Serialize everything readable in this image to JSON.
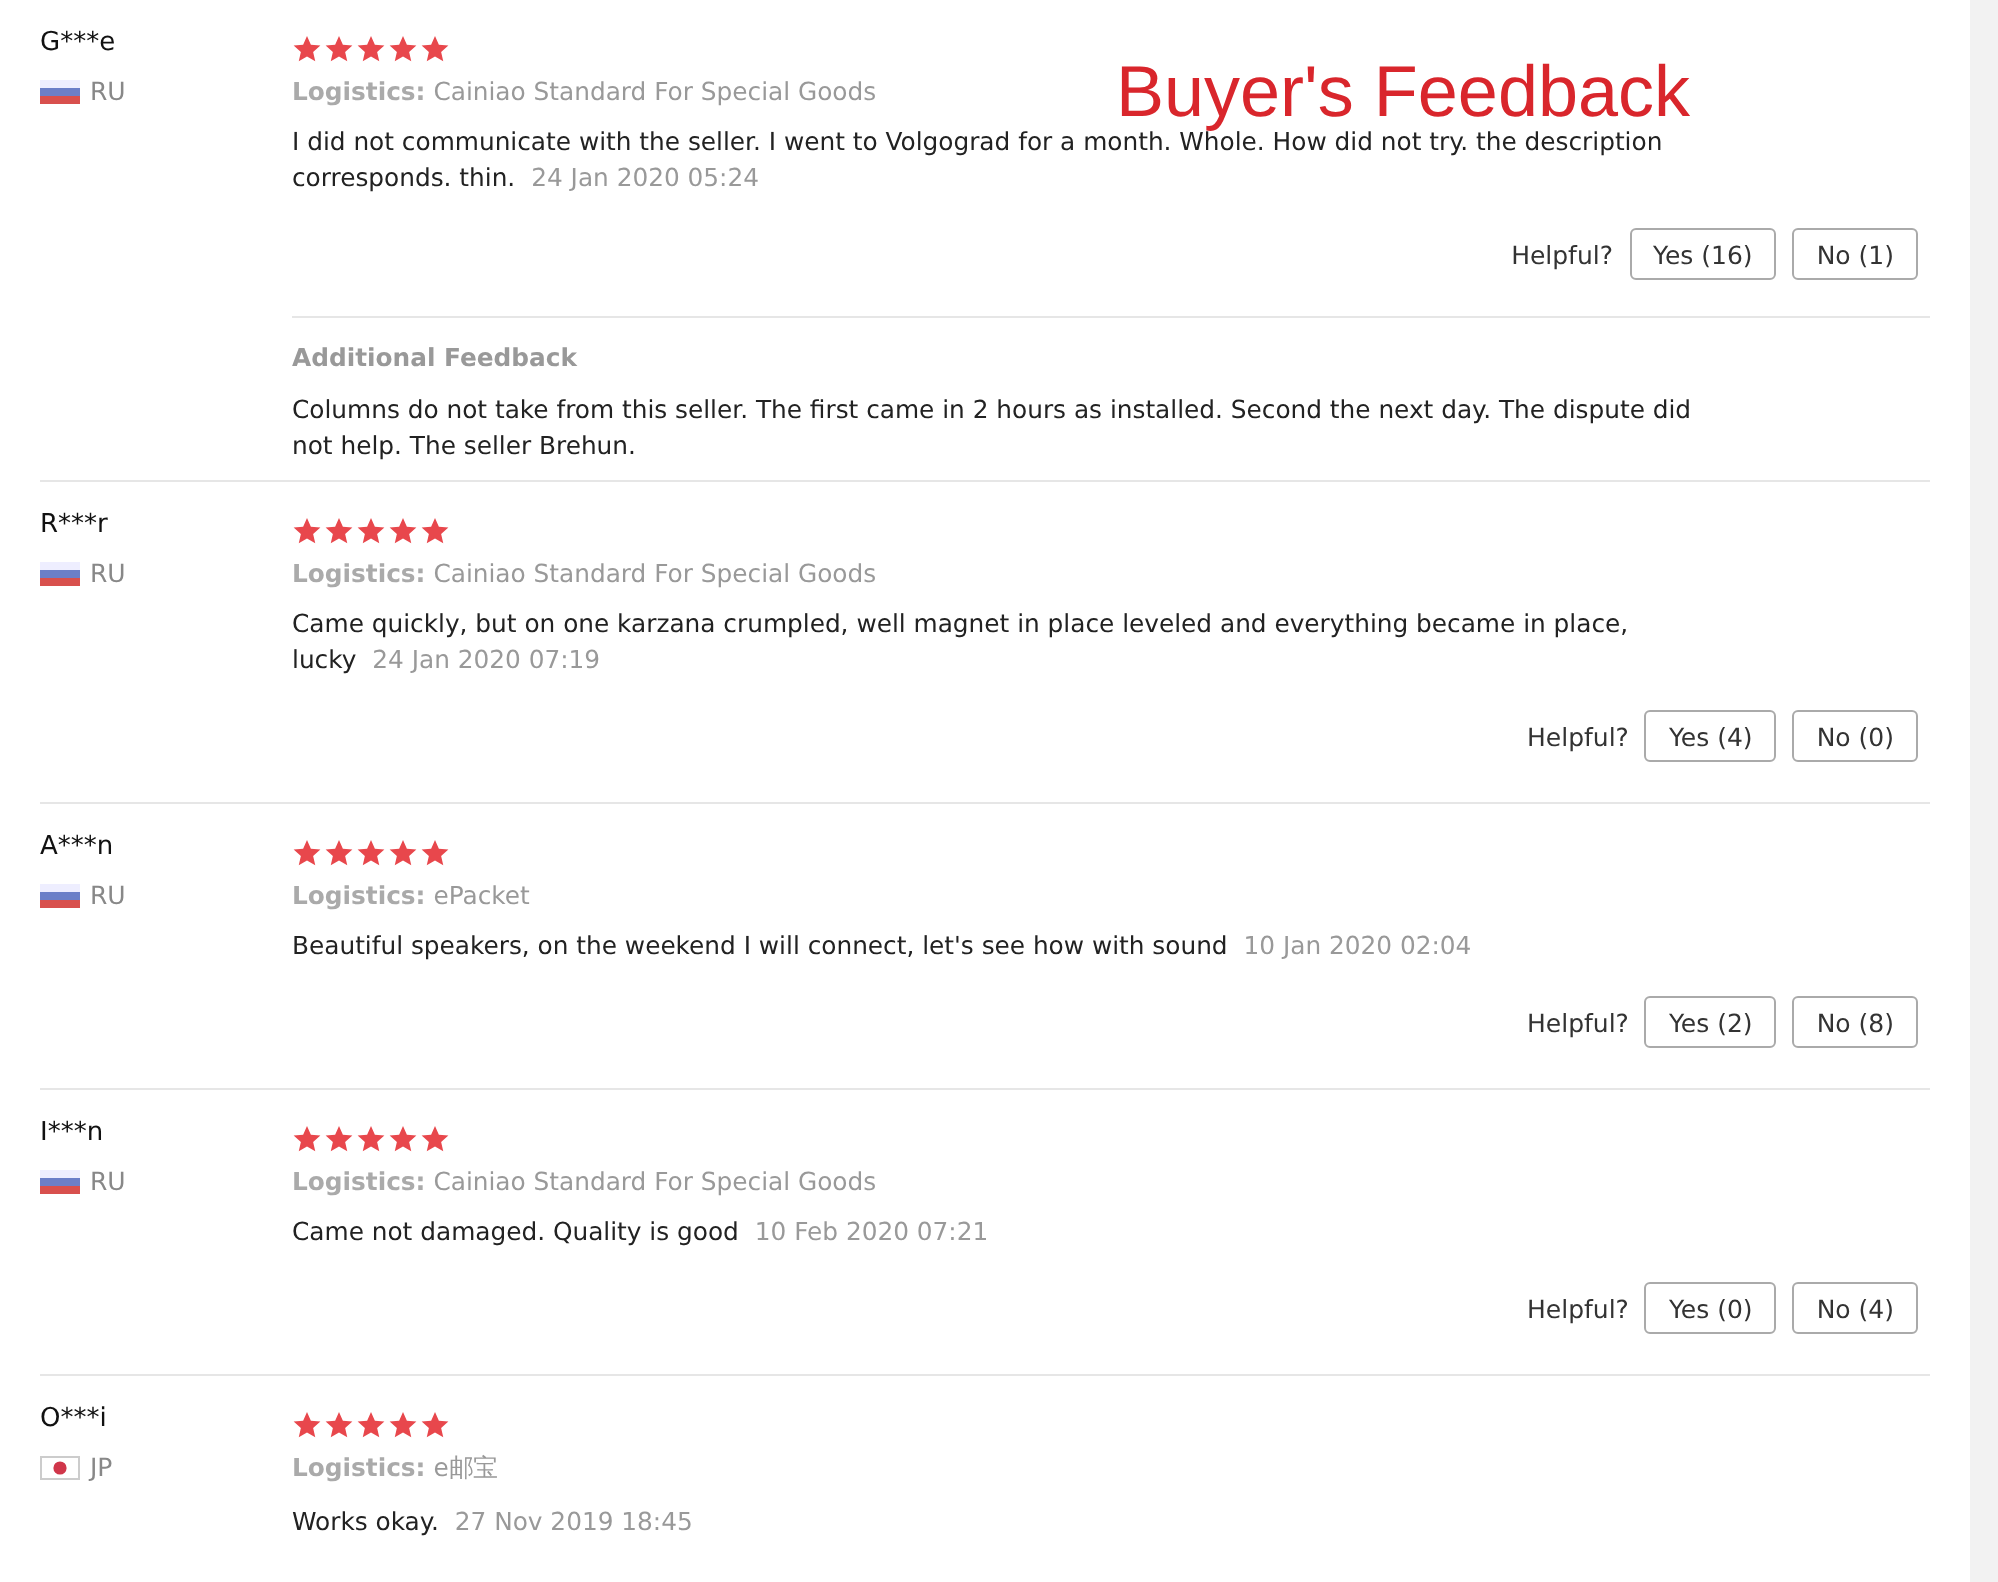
{
  "banner": "Buyer's Feedback",
  "reviews": [
    {
      "name": "G***e",
      "flag": {
        "kind": "ru"
      },
      "country": "RU",
      "stars": 5,
      "logistics_label": "Logistics:",
      "logistics": "Cainiao Standard For Special Goods",
      "text": "I did not communicate with the seller. I went to Volgograd for a month. Whole. How did not try. the description corresponds. thin.",
      "date": "24 Jan 2020 05:24",
      "helpful_label": "Helpful?",
      "yes": "Yes (16)",
      "no": "No (1)",
      "additional": {
        "title": "Additional Feedback",
        "text": "Columns do not take from this seller. The first came in 2 hours as installed. Second the next day. The dispute did not help. The seller Brehun."
      }
    },
    {
      "name": "R***r",
      "flag": {
        "kind": "ru"
      },
      "country": "RU",
      "stars": 5,
      "logistics_label": "Logistics:",
      "logistics": "Cainiao Standard For Special Goods",
      "text": "Came quickly, but on one karzana crumpled, well magnet in place leveled and everything became in place, lucky",
      "date": "24 Jan 2020 07:19",
      "helpful_label": "Helpful?",
      "yes": "Yes (4)",
      "no": "No (0)"
    },
    {
      "name": "A***n",
      "flag": {
        "kind": "ru"
      },
      "country": "RU",
      "stars": 5,
      "logistics_label": "Logistics:",
      "logistics": "ePacket",
      "text": "Beautiful speakers, on the weekend I will connect, let's see how with sound",
      "date": "10 Jan 2020 02:04",
      "helpful_label": "Helpful?",
      "yes": "Yes (2)",
      "no": "No (8)"
    },
    {
      "name": "I***n",
      "flag": {
        "kind": "ru"
      },
      "country": "RU",
      "stars": 5,
      "logistics_label": "Logistics:",
      "logistics": "Cainiao Standard For Special Goods",
      "text": "Came not damaged. Quality is good",
      "date": "10 Feb 2020 07:21",
      "helpful_label": "Helpful?",
      "yes": "Yes (0)",
      "no": "No (4)"
    },
    {
      "name": "O***i",
      "flag": {
        "kind": "jp"
      },
      "country": "JP",
      "stars": 5,
      "logistics_label": "Logistics:",
      "logistics": "e邮宝",
      "text": "Works okay.",
      "date": "27 Nov 2019 18:45"
    }
  ]
}
